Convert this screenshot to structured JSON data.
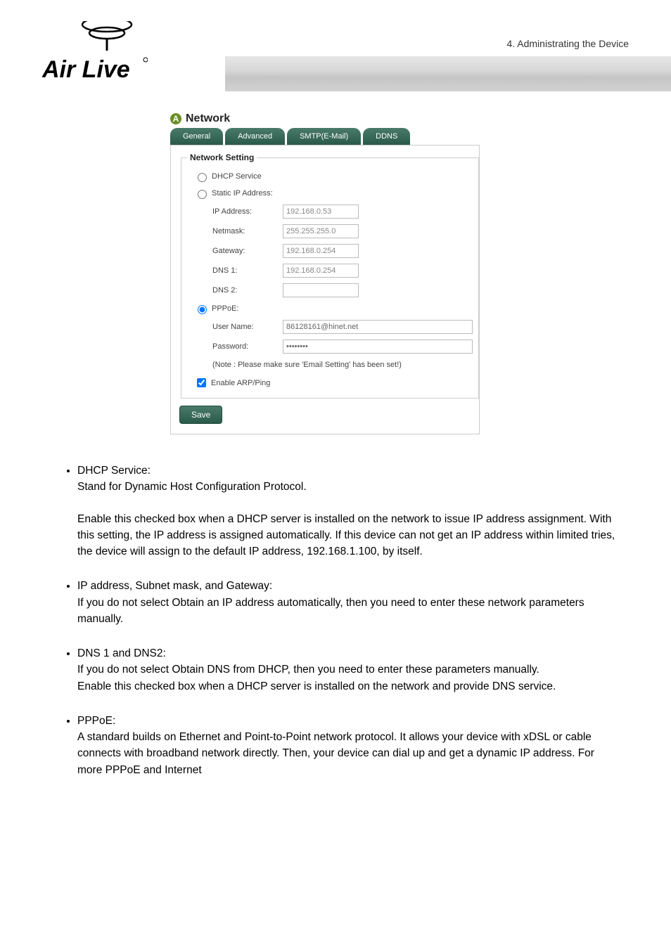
{
  "chapter": "4.  Administrating  the  Device",
  "logo_text": "Air Live",
  "panel": {
    "title": "Network",
    "tabs": [
      "General",
      "Advanced",
      "SMTP(E-Mail)",
      "DDNS"
    ],
    "legend": "Network Setting",
    "radio_dhcp": "DHCP Service",
    "radio_static": "Static IP Address:",
    "fields": {
      "ip_label": "IP Address:",
      "ip_value": "192.168.0.53",
      "netmask_label": "Netmask:",
      "netmask_value": "255.255.255.0",
      "gateway_label": "Gateway:",
      "gateway_value": "192.168.0.254",
      "dns1_label": "DNS 1:",
      "dns1_value": "192.168.0.254",
      "dns2_label": "DNS 2:",
      "dns2_value": ""
    },
    "radio_pppoe": "PPPoE:",
    "pppoe": {
      "user_label": "User Name:",
      "user_value": "86128161@hinet.net",
      "pass_label": "Password:",
      "pass_value": "••••••••"
    },
    "note": "(Note : Please make sure 'Email Setting' has been set!)",
    "check_arp": "Enable ARP/Ping",
    "save": "Save"
  },
  "body": {
    "item1_title": "DHCP Service:",
    "item1_line1": "Stand for Dynamic Host Configuration Protocol.",
    "item1_para": "Enable this checked box when a DHCP server is installed on the network to issue IP address assignment.    With this setting, the IP address is assigned automatically.    If this device can not get an IP address within limited tries, the device will assign to the default IP address, 192.168.1.100, by itself.",
    "item2_title": "IP address, Subnet mask, and Gateway:",
    "item2_para": "If you do not select Obtain an IP address automatically, then you need to enter these network parameters manually.",
    "item3_title": "DNS 1 and DNS2:",
    "item3_line1": "If you do not select Obtain DNS from DHCP, then you need to enter these parameters manually.",
    "item3_line2": "Enable this checked box when a DHCP server is installed on the network and provide DNS service.",
    "item4_title": "PPPoE:",
    "item4_para": "A standard builds on Ethernet and Point-to-Point network protocol.    It allows your device with xDSL or cable connects with broadband network directly.    Then, your device can dial up and get a dynamic IP address.    For more PPPoE and Internet"
  }
}
